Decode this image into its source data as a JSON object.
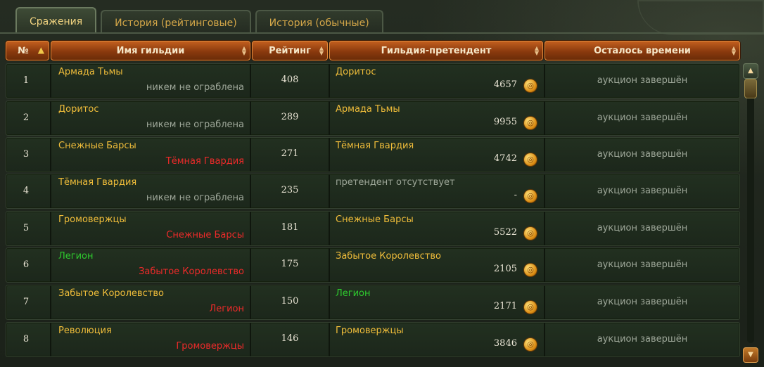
{
  "tabs": [
    {
      "label": "Сражения"
    },
    {
      "label": "История (рейтинговые)"
    },
    {
      "label": "История (обычные)"
    }
  ],
  "columns": {
    "num": "№",
    "guild": "Имя гильдии",
    "rating": "Рейтинг",
    "challenger": "Гильдия-претендент",
    "time": "Осталось времени"
  },
  "rows": [
    {
      "num": "1",
      "guild": "Армада Тьмы",
      "robbed_by": "никем не ограблена",
      "rating": "408",
      "challenger": "Доритос",
      "bid": "4657",
      "time": "аукцион завершён"
    },
    {
      "num": "2",
      "guild": "Доритос",
      "robbed_by": "никем не ограблена",
      "rating": "289",
      "challenger": "Армада Тьмы",
      "bid": "9955",
      "time": "аукцион завершён"
    },
    {
      "num": "3",
      "guild": "Снежные Барсы",
      "robbed_by": "Тёмная Гвардия",
      "rating": "271",
      "challenger": "Тёмная Гвардия",
      "bid": "4742",
      "time": "аукцион завершён"
    },
    {
      "num": "4",
      "guild": "Тёмная Гвардия",
      "robbed_by": "никем не ограблена",
      "rating": "235",
      "challenger": "претендент отсутствует",
      "bid": "-",
      "time": "аукцион завершён"
    },
    {
      "num": "5",
      "guild": "Громовержцы",
      "robbed_by": "Снежные Барсы",
      "rating": "181",
      "challenger": "Снежные Барсы",
      "bid": "5522",
      "time": "аукцион завершён"
    },
    {
      "num": "6",
      "guild": "Легион",
      "robbed_by": "Забытое Королевство",
      "rating": "175",
      "challenger": "Забытое Королевство",
      "bid": "2105",
      "time": "аукцион завершён"
    },
    {
      "num": "7",
      "guild": "Забытое Королевство",
      "robbed_by": "Легион",
      "rating": "150",
      "challenger": "Легион",
      "bid": "2171",
      "time": "аукцион завершён"
    },
    {
      "num": "8",
      "guild": "Революция",
      "robbed_by": "Громовержцы",
      "rating": "146",
      "challenger": "Громовержцы",
      "bid": "3846",
      "time": "аукцион завершён"
    }
  ],
  "colors": {
    "guild_name": "#f0bd3a",
    "robber_red": "#ee2a2a",
    "muted_grey": "#9fa89a",
    "highlight_green": "#2ecb2e",
    "header_orange": "#c25e1e"
  },
  "icons": {
    "sort_ascending": "arrow-up-icon",
    "sortable": "sort-arrows-icon",
    "currency": "gold-coin-icon",
    "scroll_up": "scroll-up-icon",
    "scroll_down": "scroll-down-icon"
  }
}
